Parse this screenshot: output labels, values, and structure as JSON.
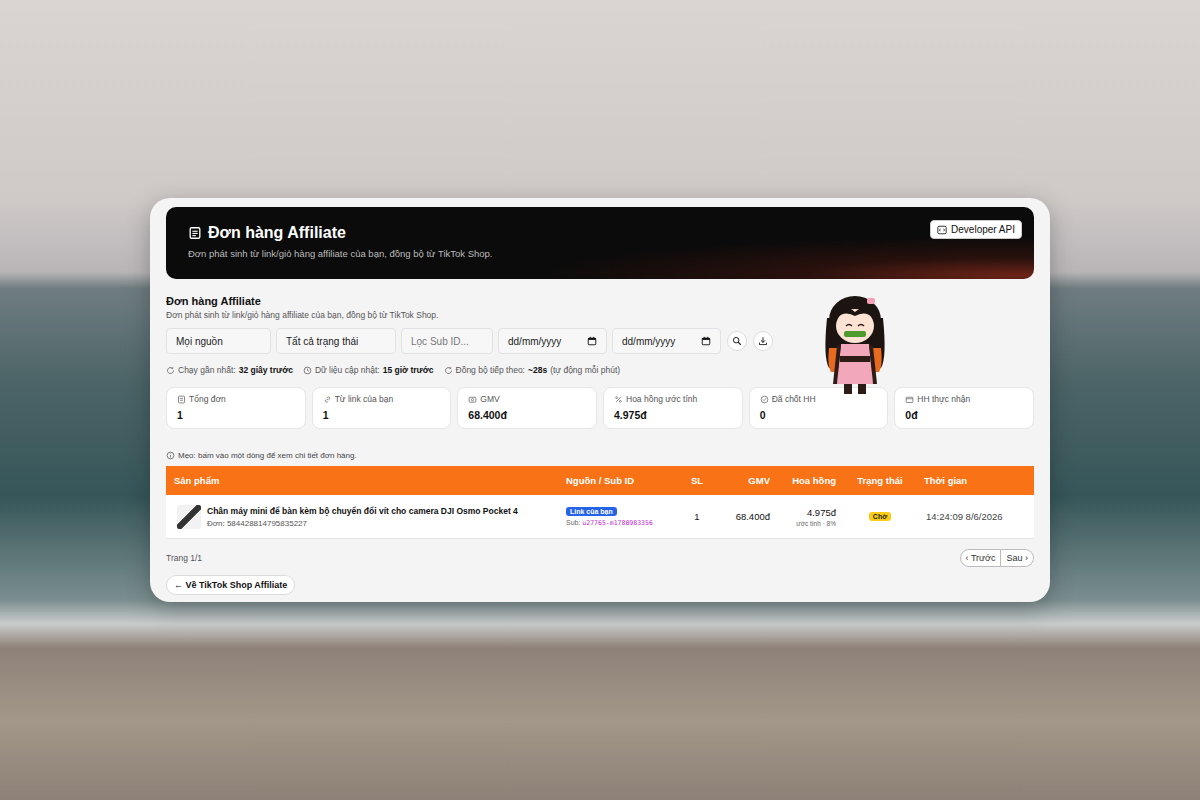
{
  "header": {
    "title": "Đơn hàng Affiliate",
    "subtitle": "Đơn phát sinh từ link/giỏ hàng affiliate của bạn, đồng bộ từ TikTok Shop.",
    "api_button": "Developer API"
  },
  "section": {
    "title": "Đơn hàng Affiliate",
    "subtitle": "Đơn phát sinh từ link/giỏ hàng affiliate của bạn, đồng bộ từ TikTok Shop."
  },
  "filters": {
    "source": "Mọi nguồn",
    "status": "Tất cả trạng thái",
    "sub_id_placeholder": "Lọc Sub ID...",
    "date_from_placeholder": "dd/mm/yyyy",
    "date_to_placeholder": "dd/mm/yyyy"
  },
  "sync_status": [
    {
      "label": "Chạy gần nhất:",
      "value": "32 giây trước"
    },
    {
      "label": "Dữ liệu cập nhật:",
      "value": "15 giờ trước"
    },
    {
      "label": "Đồng bộ tiếp theo:",
      "value": "~28s",
      "note": "(tự động mỗi phút)"
    }
  ],
  "stats": [
    {
      "label": "Tổng đơn",
      "value": "1"
    },
    {
      "label": "Từ link của bạn",
      "value": "1"
    },
    {
      "label": "GMV",
      "value": "68.400đ"
    },
    {
      "label": "Hoa hồng ước tính",
      "value": "4.975đ"
    },
    {
      "label": "Đã chốt HH",
      "value": "0"
    },
    {
      "label": "HH thực nhận",
      "value": "0đ"
    }
  ],
  "tip": "Mẹo: bấm vào một dòng để xem chi tiết đơn hàng.",
  "table": {
    "columns": [
      "Sản phẩm",
      "Nguồn / Sub ID",
      "SL",
      "GMV",
      "Hoa hồng",
      "Trạng thái",
      "Thời gian"
    ],
    "rows": [
      {
        "product": "Chân máy mini để bàn kèm bộ chuyển đổi vít cho camera DJI Osmo Pocket 4",
        "order": "Đơn: 584428814795835227",
        "source": "Link của bạn",
        "sub_label": "Sub:",
        "sub_id": "u27765-m1780983356",
        "quantity": "1",
        "gmv": "68.400đ",
        "commission": "4.975đ",
        "commission_note": "ước tính · 8%",
        "status": "Chờ",
        "time": "14:24:09 8/6/2026"
      }
    ]
  },
  "pagination": {
    "page": "Trang 1/1",
    "prev": "‹ Trước",
    "next": "Sau ›"
  },
  "back_button": "← Về TikTok Shop Affiliate"
}
